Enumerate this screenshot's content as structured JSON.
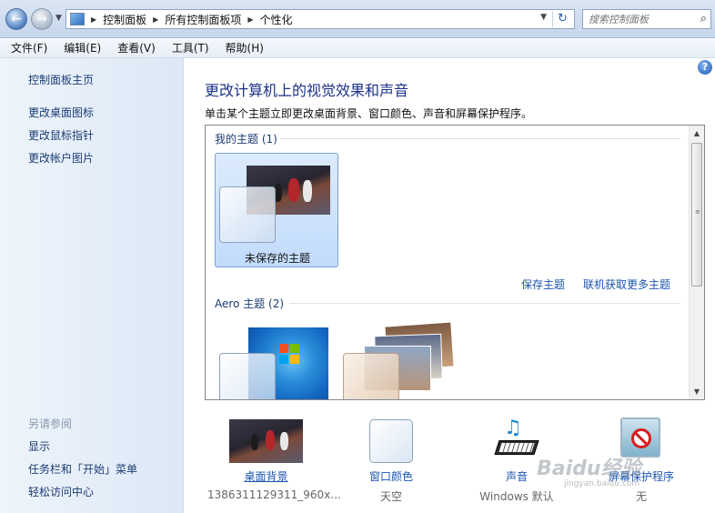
{
  "addressbar": {
    "crumbs": [
      "控制面板",
      "所有控制面板项",
      "个性化"
    ],
    "search_placeholder": "搜索控制面板"
  },
  "menu": [
    "文件(F)",
    "编辑(E)",
    "查看(V)",
    "工具(T)",
    "帮助(H)"
  ],
  "sidebar": {
    "home": "控制面板主页",
    "links": [
      "更改桌面图标",
      "更改鼠标指针",
      "更改帐户图片"
    ],
    "see_also": "另请参阅",
    "see_also_links": [
      "显示",
      "任务栏和「开始」菜单",
      "轻松访问中心"
    ]
  },
  "main": {
    "title": "更改计算机上的视觉效果和声音",
    "subtitle": "单击某个主题立即更改桌面背景、窗口颜色、声音和屏幕保护程序。",
    "my_themes_header": "我的主题 (1)",
    "unsaved_theme_label": "未保存的主题",
    "save_theme": "保存主题",
    "get_more_online": "联机获取更多主题",
    "aero_header": "Aero 主题 (2)"
  },
  "bottom": {
    "items": [
      {
        "label": "桌面背景",
        "sub": "1386311129311_960x..."
      },
      {
        "label": "窗口颜色",
        "sub": "天空"
      },
      {
        "label": "声音",
        "sub": "Windows 默认"
      },
      {
        "label": "屏幕保护程序",
        "sub": "无"
      }
    ]
  },
  "watermark": {
    "text": "Baidu经验",
    "sub": "jingyan.baidu.com"
  }
}
